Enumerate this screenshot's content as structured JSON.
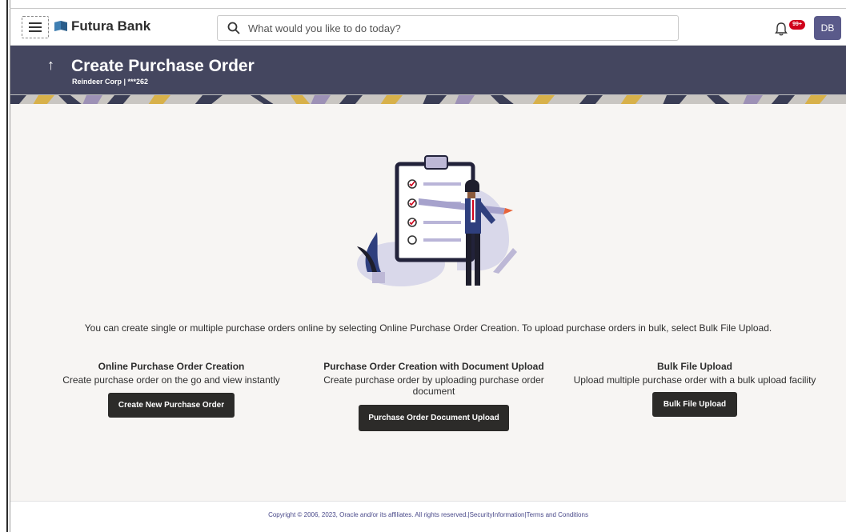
{
  "app": {
    "brand": "Futura Bank"
  },
  "search": {
    "placeholder": "What would you like to do today?"
  },
  "notifications": {
    "badge": "99+"
  },
  "user": {
    "initials": "DB"
  },
  "page": {
    "back_icon": "↑",
    "title": "Create Purchase Order",
    "subtitle": "Reindeer Corp | ***262"
  },
  "intro": "You can create single or multiple purchase orders online by selecting Online Purchase Order Creation. To upload purchase orders in bulk, select Bulk File Upload.",
  "options": [
    {
      "title": "Online Purchase Order Creation",
      "description": "Create purchase order on the go and view instantly",
      "button": "Create New Purchase Order"
    },
    {
      "title": "Purchase Order Creation with Document Upload",
      "description": "Create purchase order by uploading purchase order document",
      "button": "Purchase Order Document Upload"
    },
    {
      "title": "Bulk File Upload",
      "description": "Upload multiple purchase order with a bulk upload facility",
      "button": "Bulk File Upload"
    }
  ],
  "footer": "Copyright © 2006, 2023, Oracle and/or its affiliates. All rights reserved.|SecurityInformation|Terms and Conditions",
  "colors": {
    "header_bg": "#44465f",
    "button_bg": "#2c2b29",
    "accent": "#5a5a8a",
    "badge": "#d0021b"
  },
  "icons": [
    "hamburger-icon",
    "bank-logo-icon",
    "search-icon",
    "bell-icon",
    "back-arrow-icon",
    "clipboard-illustration"
  ]
}
